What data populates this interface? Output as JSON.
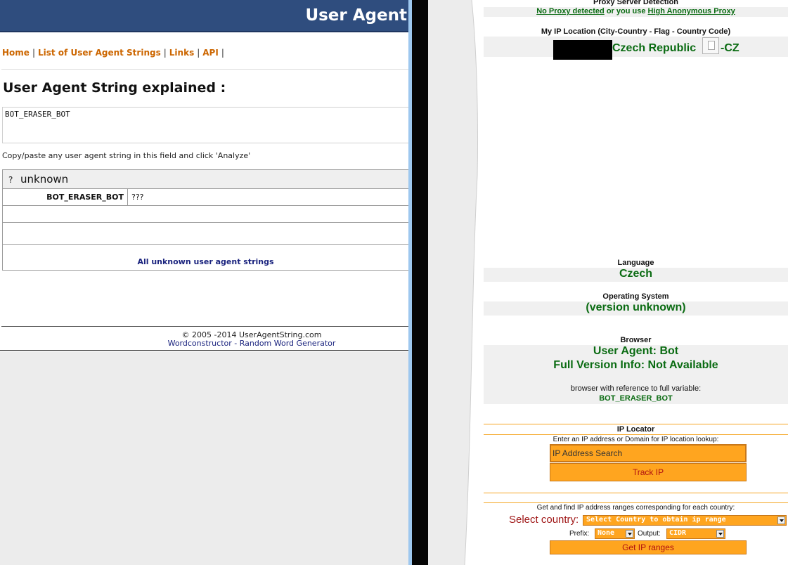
{
  "left": {
    "header_title": "User Agent",
    "nav": {
      "home": "Home",
      "list": "List of User Agent Strings",
      "links": "Links",
      "api": "API",
      "sep": "|"
    },
    "heading": "User Agent String explained :",
    "input_value": "BOT_ERASER_BOT",
    "hint": "Copy/paste any user agent string in this field and click 'Analyze'",
    "result": {
      "icon": "?",
      "title": "unknown",
      "key": "BOT_ERASER_BOT",
      "value": "???",
      "all_link": "All unknown user agent strings"
    },
    "footer": {
      "copyright": "© 2005 -2014 UserAgentString.com",
      "link": "Wordconstructor - Random Word Generator"
    }
  },
  "right": {
    "proxy": {
      "label": "Proxy Server Detection",
      "no_proxy": "No Proxy detected",
      "or_text": " or you use ",
      "high_anon": "High Anonymous Proxy"
    },
    "ip_location": {
      "label": "My IP Location (City-Country - Flag - Country Code)",
      "country": "Czech Republic",
      "code": "-CZ"
    },
    "language": {
      "label": "Language",
      "value": "Czech"
    },
    "os": {
      "label": "Operating System",
      "value": "(version unknown)"
    },
    "browser": {
      "label": "Browser",
      "user_agent": "User Agent: Bot",
      "full_version": "Full Version Info: Not Available",
      "ref_text": "browser with reference to full variable:",
      "variable": "BOT_ERASER_BOT"
    },
    "ip_locator": {
      "label": "IP Locator",
      "hint": "Enter an IP address or Domain for IP location lookup:",
      "placeholder": "IP Address Search",
      "track_button": "Track IP"
    },
    "ranges": {
      "hint": "Get and find IP address ranges corresponding for each country:",
      "select_label": "Select country:",
      "country_select": "Select Country to obtain ip range",
      "prefix_label": "Prefix:",
      "prefix_value": "None",
      "output_label": "Output:",
      "output_value": "CIDR",
      "get_button": "Get IP ranges"
    }
  },
  "colors": {
    "header_blue": "#2f4d7e",
    "link_orange": "#cc6600",
    "green": "#0a6b12",
    "orange_field": "#ffa51f",
    "button_text_red": "#b01010"
  }
}
